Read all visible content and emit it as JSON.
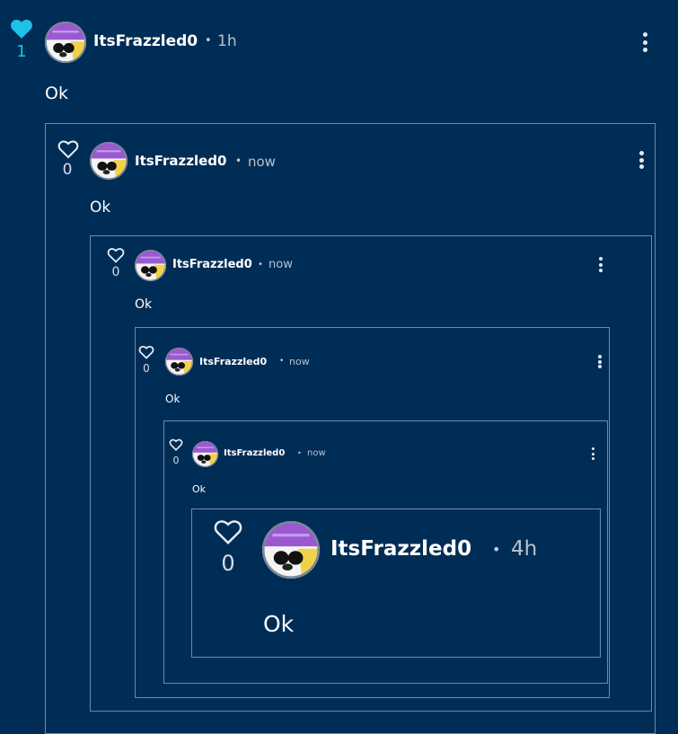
{
  "colors": {
    "background": "#002d56",
    "liked_heart": "#1ec2e6",
    "border": "#6f8aa6"
  },
  "icons": {
    "like": "heart-icon",
    "menu": "more-vertical-icon"
  },
  "comments": [
    {
      "author": "ItsFrazzled0",
      "separator": "•",
      "time": "1h",
      "likes": "1",
      "liked": true,
      "text": "Ok"
    },
    {
      "author": "ItsFrazzled0",
      "separator": "•",
      "time": "now",
      "likes": "0",
      "liked": false,
      "text": "Ok"
    },
    {
      "author": "ItsFrazzled0",
      "separator": "•",
      "time": "now",
      "likes": "0",
      "liked": false,
      "text": "Ok"
    },
    {
      "author": "ItsFrazzled0",
      "separator": "•",
      "time": "now",
      "likes": "0",
      "liked": false,
      "text": "Ok"
    },
    {
      "author": "ItsFrazzled0",
      "separator": "•",
      "time": "now",
      "likes": "0",
      "liked": false,
      "text": "Ok"
    },
    {
      "author": "ItsFrazzled0",
      "separator": "•",
      "time": "4h",
      "likes": "0",
      "liked": false,
      "text": "Ok"
    }
  ]
}
